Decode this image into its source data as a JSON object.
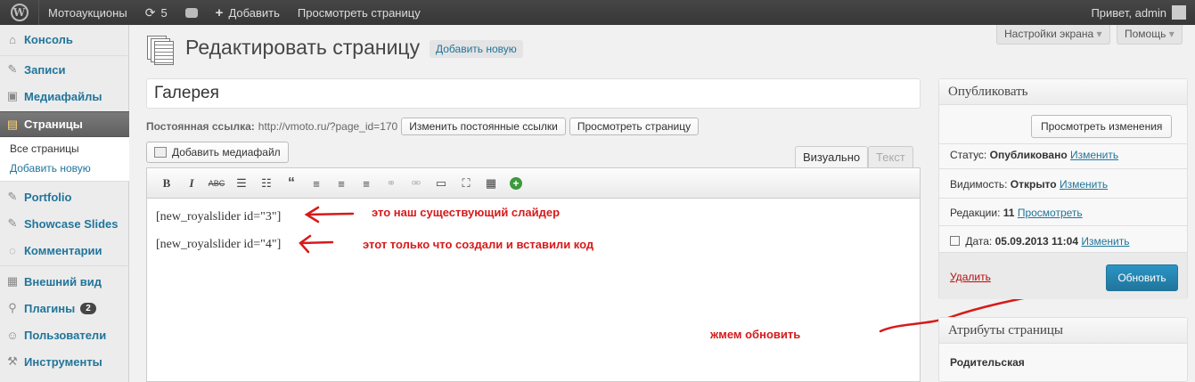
{
  "adminbar": {
    "site_name": "Мотоаукционы",
    "updates_count": "5",
    "add_label": "Добавить",
    "view_page": "Просмотреть страницу",
    "greeting": "Привет, admin"
  },
  "sidebar": {
    "items": [
      {
        "label": "Консоль",
        "icon": "dashboard-icon"
      },
      {
        "label": "Записи",
        "icon": "pin-icon"
      },
      {
        "label": "Медиафайлы",
        "icon": "media-icon"
      },
      {
        "label": "Страницы",
        "icon": "pages-icon"
      },
      {
        "label": "Portfolio",
        "icon": "pin-icon"
      },
      {
        "label": "Showcase Slides",
        "icon": "pin-icon"
      },
      {
        "label": "Комментарии",
        "icon": "comment-icon"
      },
      {
        "label": "Внешний вид",
        "icon": "appearance-icon"
      },
      {
        "label": "Плагины",
        "icon": "plugin-icon",
        "badge": "2"
      },
      {
        "label": "Пользователи",
        "icon": "users-icon"
      },
      {
        "label": "Инструменты",
        "icon": "tools-icon"
      }
    ],
    "submenu": [
      "Все страницы",
      "Добавить новую"
    ]
  },
  "screen_options": "Настройки экрана",
  "help": "Помощь",
  "page": {
    "title": "Редактировать страницу",
    "add_new": "Добавить новую",
    "post_title": "Галерея",
    "permalink_label": "Постоянная ссылка:",
    "permalink_url": "http://vmoto.ru/?page_id=170",
    "change_permalinks": "Изменить постоянные ссылки",
    "view_page": "Просмотреть страницу",
    "add_media": "Добавить медиафайл",
    "tab_visual": "Визуально",
    "tab_text": "Текст"
  },
  "editor": {
    "line1": "[new_royalslider id=\"3\"]",
    "line2": "[new_royalslider id=\"4\"]"
  },
  "annotations": {
    "a1": "это наш существующий слайдер",
    "a2": "этот только что создали и вставили код",
    "a3": "жмем обновить",
    "color": "#d71a1a"
  },
  "publish": {
    "title": "Опубликовать",
    "preview": "Просмотреть изменения",
    "status_label": "Статус:",
    "status_value": "Опубликовано",
    "status_edit": "Изменить",
    "visibility_label": "Видимость:",
    "visibility_value": "Открыто",
    "visibility_edit": "Изменить",
    "revisions_label": "Редакции:",
    "revisions_value": "11",
    "revisions_link": "Просмотреть",
    "date_label": "Дата:",
    "date_value": "05.09.2013 11:04",
    "date_edit": "Изменить",
    "delete": "Удалить",
    "update": "Обновить"
  },
  "attributes": {
    "title": "Атрибуты страницы",
    "parent_label": "Родительская"
  }
}
